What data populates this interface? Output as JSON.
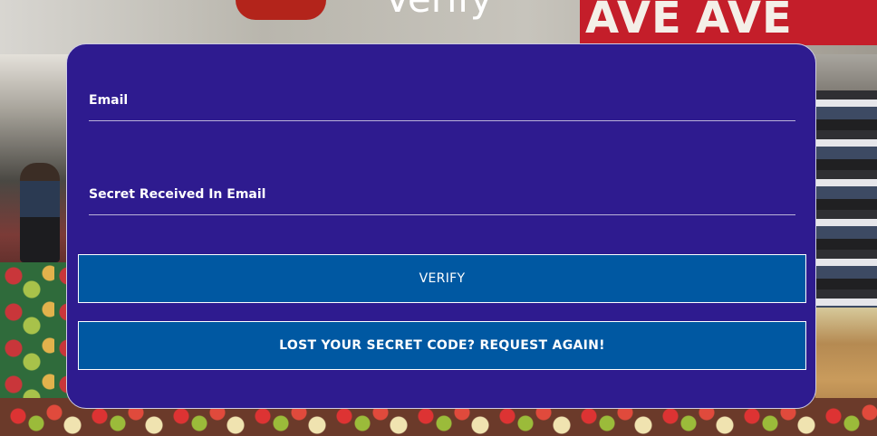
{
  "page": {
    "heading": "Verify"
  },
  "background": {
    "sign_text_1": "AVE",
    "sign_text_2": "AVE"
  },
  "form": {
    "email_label": "Email",
    "email_value": "",
    "secret_label": "Secret Received In Email",
    "secret_value": "",
    "verify_button": "VERIFY",
    "request_again_button": "LOST YOUR SECRET CODE? REQUEST AGAIN!"
  },
  "colors": {
    "card_background": "#2e1b8f",
    "button_background": "#0058a2",
    "text": "#ffffff"
  }
}
